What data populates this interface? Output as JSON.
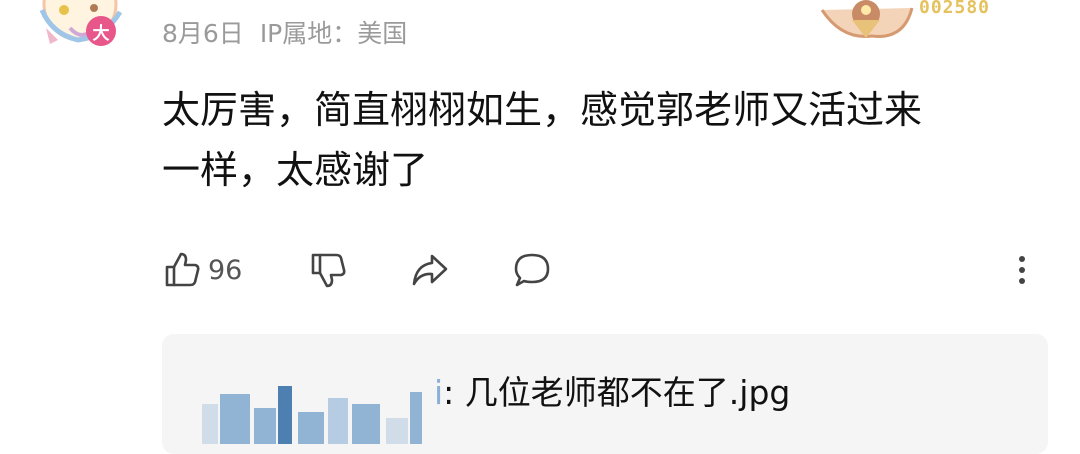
{
  "comment": {
    "date": "8月6日",
    "ip_location": "IP属地：美国",
    "text_lines": [
      "太厉害，简直栩栩如生，感觉郭老师又活过来",
      "一样，太感谢了"
    ],
    "likes": "96",
    "avatar_badge_char": "大",
    "fan_badge_number": "002580"
  },
  "actions": {
    "like_icon": "thumbs-up-icon",
    "dislike_icon": "thumbs-down-icon",
    "share_icon": "share-icon",
    "reply_icon": "comment-bubble-icon",
    "more_icon": "more-vertical-icon"
  },
  "reply": {
    "prefix": "i",
    "text": ": 几位老师都不在了.jpg"
  },
  "colors": {
    "meta_gray": "#9a9a9a",
    "text_black": "#111111",
    "icon_gray": "#444444",
    "reply_bg": "#f5f5f5",
    "badge_pink": "#e8578a",
    "badge_gold": "#e6c25e"
  }
}
